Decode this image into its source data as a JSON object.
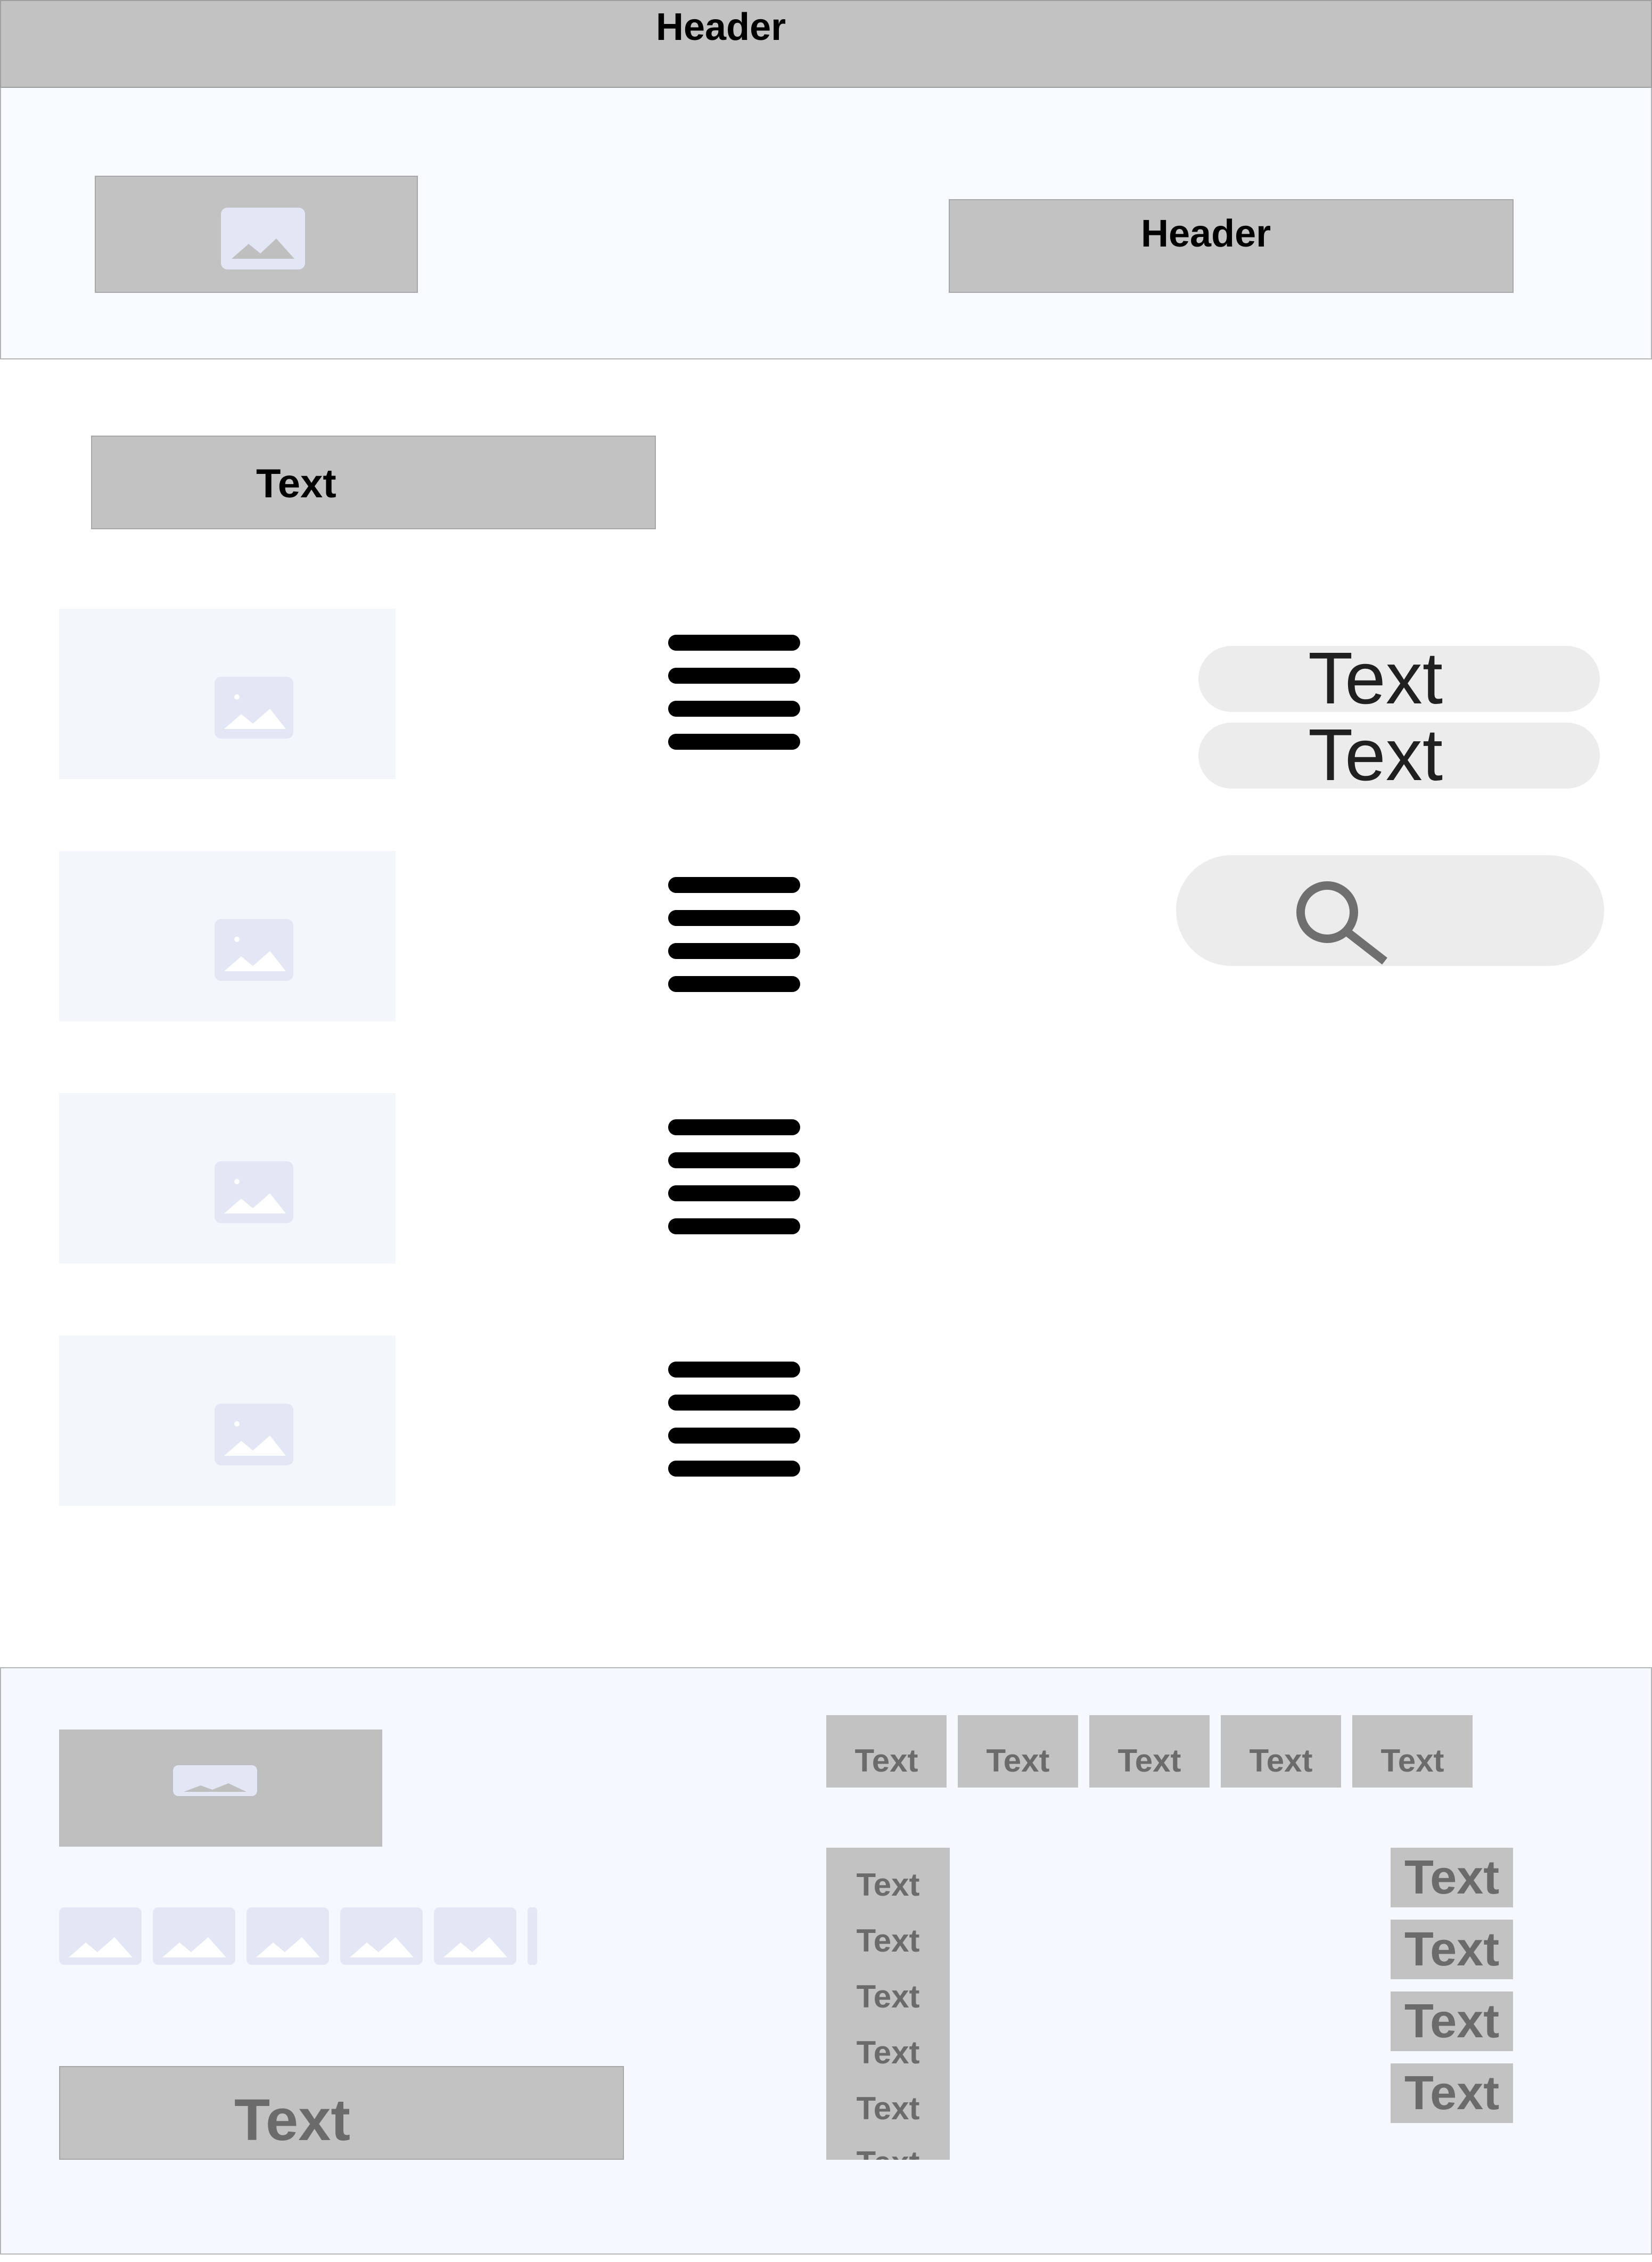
{
  "header": {
    "title": "Header"
  },
  "hero": {
    "header_label": "Header",
    "image_icon": "image-icon"
  },
  "text_block": {
    "label": "Text"
  },
  "list": {
    "items": [
      {
        "image_icon": "image-icon",
        "menu_icon": "hamburger-menu-icon"
      },
      {
        "image_icon": "image-icon",
        "menu_icon": "hamburger-menu-icon"
      },
      {
        "image_icon": "image-icon",
        "menu_icon": "hamburger-menu-icon"
      },
      {
        "image_icon": "image-icon",
        "menu_icon": "hamburger-menu-icon"
      }
    ]
  },
  "sidebar": {
    "pills": [
      "Text",
      "Text"
    ],
    "search_icon": "search-icon"
  },
  "footer": {
    "logo_icon": "image-icon",
    "social_icons": [
      "image-icon",
      "image-icon",
      "image-icon",
      "image-icon",
      "image-icon"
    ],
    "cta_label": "Text",
    "nav_tabs": [
      "Text",
      "Text",
      "Text",
      "Text",
      "Text"
    ],
    "link_column": [
      "Text",
      "Text",
      "Text",
      "Text",
      "Text",
      "Text"
    ],
    "side_links": [
      "Text",
      "Text",
      "Text",
      "Text"
    ]
  },
  "colors": {
    "header_bg": "#c2c2c2",
    "panel_bg": "#f7fbff",
    "placeholder_icon": "#e2e6f5",
    "muted_text": "#6b6b6b"
  }
}
